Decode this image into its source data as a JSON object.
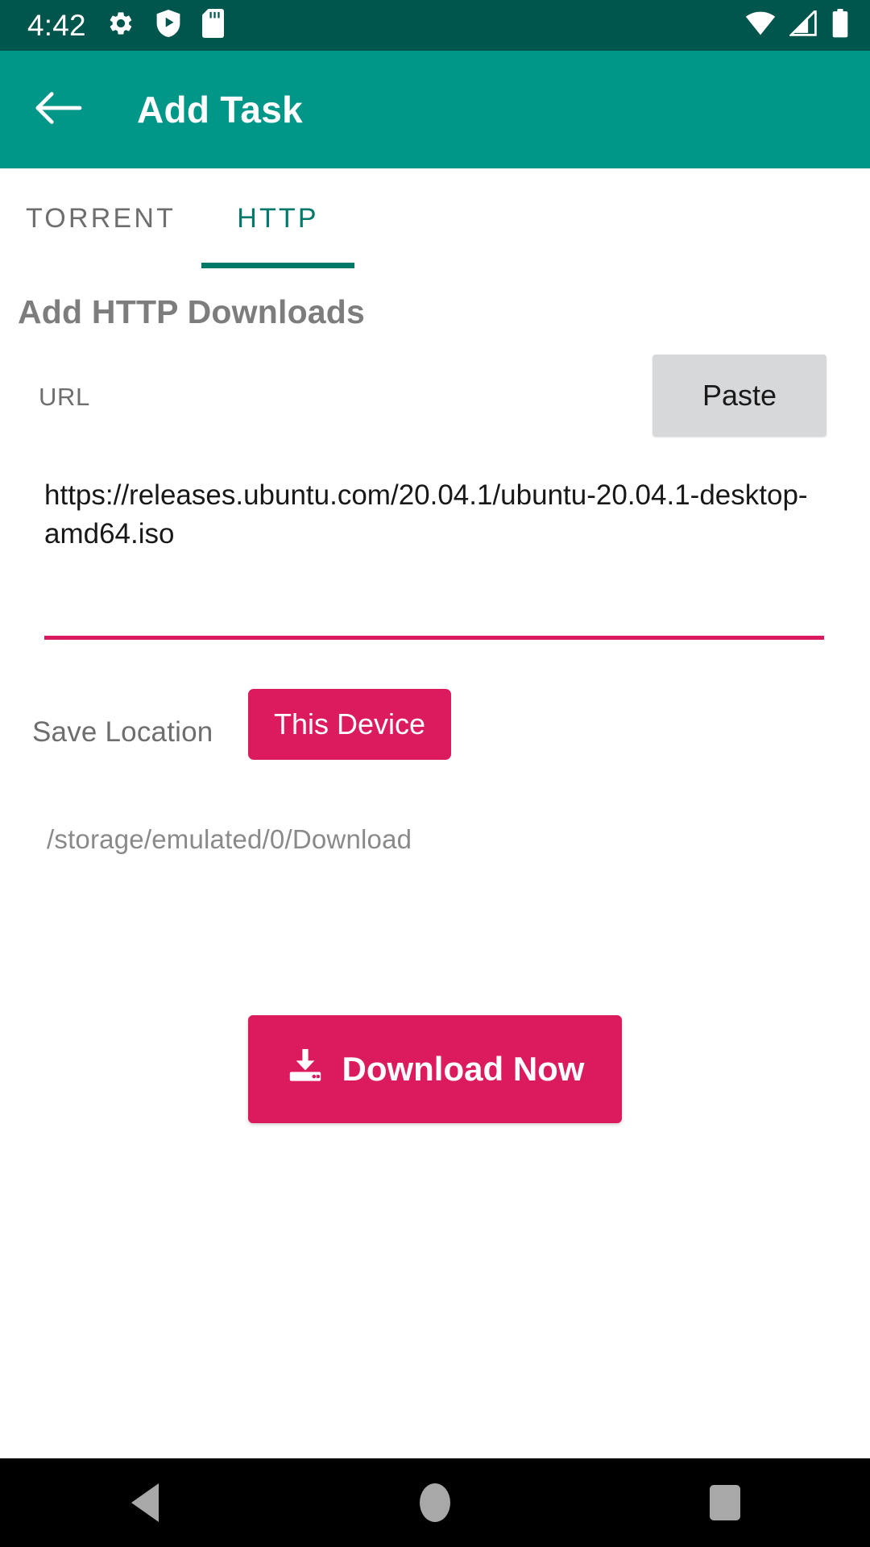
{
  "status_bar": {
    "clock": "4:42",
    "left_icons": [
      "gear-icon",
      "shield-play-icon",
      "sd-card-icon"
    ],
    "right_icons": [
      "wifi-icon",
      "cellular-signal-icon",
      "battery-icon"
    ],
    "background_color": "#00564C"
  },
  "app_bar": {
    "title": "Add Task",
    "back_icon": "arrow-left-icon",
    "background_color": "#009688"
  },
  "tabs": [
    {
      "label": "TORRENT",
      "active": false
    },
    {
      "label": "HTTP",
      "active": true
    }
  ],
  "tab_indicator_color": "#00796B",
  "form": {
    "section_title": "Add HTTP Downloads",
    "url_label": "URL",
    "paste_label": "Paste",
    "url_value": "https://releases.ubuntu.com/20.04.1/ubuntu-20.04.1-desktop-amd64.iso",
    "url_placeholder": "URL",
    "underline_color": "#D81B5E",
    "save_location_label": "Save Location",
    "save_location_value": "This Device",
    "save_path": "/storage/emulated/0/Download",
    "download_label": "Download Now",
    "download_icon": "download-tray-icon",
    "accent_color": "#DB1B5E"
  },
  "nav_bar": {
    "back_icon": "nav-back-triangle-icon",
    "home_icon": "nav-home-circle-icon",
    "recents_icon": "nav-recents-square-icon",
    "background_color": "#000000"
  }
}
